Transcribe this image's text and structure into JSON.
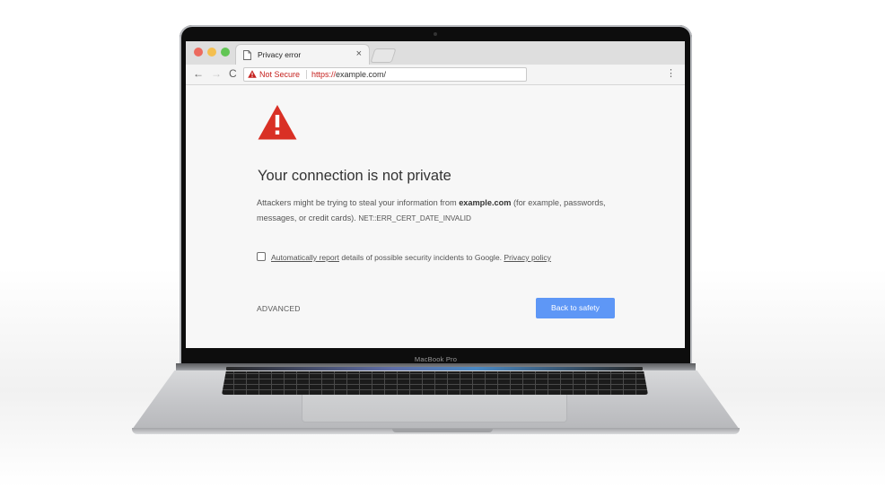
{
  "device": {
    "label": "MacBook Pro"
  },
  "browser": {
    "tab": {
      "title": "Privacy error",
      "close": "×"
    },
    "toolbar": {
      "back": "←",
      "forward": "→",
      "reload": "C",
      "security_label": "Not Secure",
      "url_scheme": "https://",
      "url_host": "example.com/",
      "menu": "⋮"
    }
  },
  "page": {
    "heading": "Your connection is not private",
    "paragraph": {
      "text_before": "Attackers might be trying to steal your information from ",
      "domain": "example.com",
      "text_after": " (for example, passwords, messages, or credit cards). ",
      "error_code": "NET::ERR_CERT_DATE_INVALID"
    },
    "report": {
      "link_text": "Automatically report",
      "text": " details of possible security incidents to Google. ",
      "policy_link": "Privacy policy",
      "checked": false
    },
    "advanced_label": "ADVANCED",
    "back_button_label": "Back to safety"
  },
  "colors": {
    "warning_red": "#d93025",
    "not_secure_red": "#c5221f",
    "button_blue": "#5e97f6"
  },
  "icons": {
    "tab": "document-icon",
    "omnibox": "warning-triangle-icon",
    "page": "warning-triangle-icon"
  }
}
